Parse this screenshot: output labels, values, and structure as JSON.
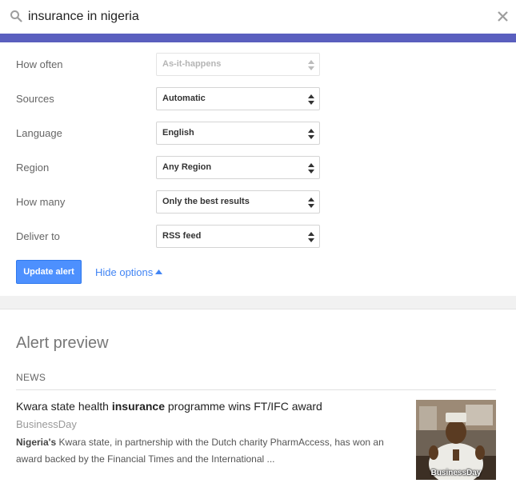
{
  "search": {
    "query": "insurance in nigeria"
  },
  "colors": {
    "accent_bar": "#5a5fbf",
    "button_blue": "#4d90fe",
    "link_blue": "#4285f4"
  },
  "options": [
    {
      "label": "How often",
      "value": "As-it-happens",
      "disabled": true
    },
    {
      "label": "Sources",
      "value": "Automatic",
      "disabled": false
    },
    {
      "label": "Language",
      "value": "English",
      "disabled": false
    },
    {
      "label": "Region",
      "value": "Any Region",
      "disabled": false
    },
    {
      "label": "How many",
      "value": "Only the best results",
      "disabled": false
    },
    {
      "label": "Deliver to",
      "value": "RSS feed",
      "disabled": false
    }
  ],
  "actions": {
    "update_label": "Update alert",
    "hide_options_label": "Hide options"
  },
  "preview": {
    "heading": "Alert preview",
    "section": "NEWS",
    "article": {
      "title_before": "Kwara state health ",
      "title_bold": "insurance",
      "title_after": " programme wins FT/IFC award",
      "source": "BusinessDay",
      "snippet_bold": "Nigeria's",
      "snippet_rest": " Kwara state, in partnership with the Dutch charity PharmAccess, has won an award backed by the Financial Times and the International ...",
      "thumbnail_caption": "BusinessDay"
    }
  }
}
